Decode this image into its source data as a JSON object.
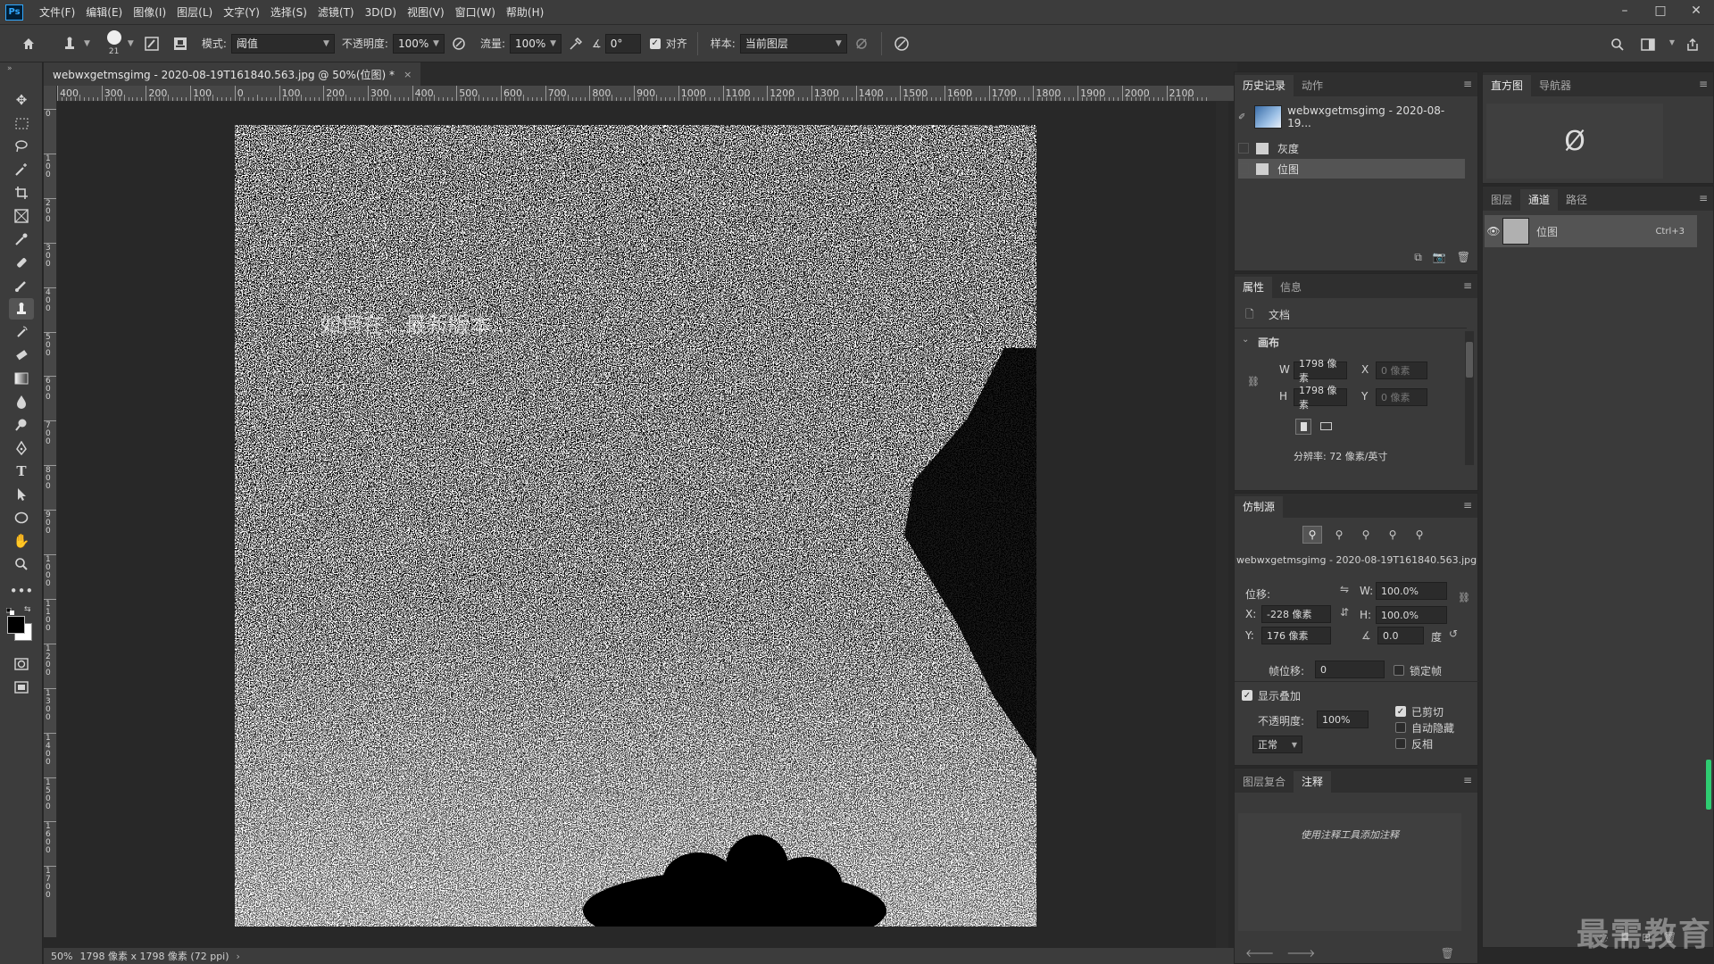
{
  "app": {
    "logo": "Ps"
  },
  "menu": [
    "文件(F)",
    "编辑(E)",
    "图像(I)",
    "图层(L)",
    "文字(Y)",
    "选择(S)",
    "滤镜(T)",
    "3D(D)",
    "视图(V)",
    "窗口(W)",
    "帮助(H)"
  ],
  "window_controls": {
    "minimize": "–",
    "maximize": "□",
    "close": "✕"
  },
  "options": {
    "brush_size": "21",
    "mode_label": "模式:",
    "mode_value": "阈值",
    "opacity_label": "不透明度:",
    "opacity_value": "100%",
    "flow_label": "流量:",
    "flow_value": "100%",
    "angle_value": "0°",
    "align_label": "对齐",
    "sample_label": "样本:",
    "sample_value": "当前图层"
  },
  "document": {
    "tab_title": "webwxgetmsgimg - 2020-08-19T161840.563.jpg @ 50%(位图) *",
    "close": "×",
    "image_text": "如何在…最新版本…"
  },
  "ruler": {
    "h_labels": [
      "400",
      "300",
      "200",
      "100",
      "0",
      "100",
      "200",
      "300",
      "400",
      "500",
      "600",
      "700",
      "800",
      "900",
      "1000",
      "1100",
      "1200",
      "1300",
      "1400",
      "1500",
      "1600",
      "1700",
      "1800",
      "1900",
      "2000",
      "2100"
    ],
    "v_labels": [
      "0",
      "1 0 0",
      "2 0 0",
      "3 0 0",
      "4 0 0",
      "5 0 0",
      "6 0 0",
      "7 0 0",
      "8 0 0",
      "9 0 0",
      "1 0 0 0",
      "1 1 0 0",
      "1 2 0 0",
      "1 3 0 0",
      "1 4 0 0",
      "1 5 0 0",
      "1 6 0 0",
      "1 7 0 0"
    ]
  },
  "status": {
    "zoom": "50%",
    "info": "1798 像素 x 1798 像素 (72 ppi)"
  },
  "history_panel": {
    "tabs": [
      "历史记录",
      "动作"
    ],
    "snapshot": "webwxgetmsgimg - 2020-08-19...",
    "steps": [
      "灰度",
      "位图"
    ]
  },
  "histogram_panel": {
    "tabs": [
      "直方图",
      "导航器"
    ],
    "empty_icon": "Ø"
  },
  "layers_panel": {
    "tabs": [
      "图层",
      "通道",
      "路径"
    ],
    "channel": {
      "name": "位图",
      "shortcut": "Ctrl+3"
    }
  },
  "properties_panel": {
    "tabs": [
      "属性",
      "信息"
    ],
    "doc_label": "文档",
    "section": "画布",
    "w_label": "W",
    "w_value": "1798 像素",
    "h_label": "H",
    "h_value": "1798 像素",
    "x_label": "X",
    "x_value": "0 像素",
    "y_label": "Y",
    "y_value": "0 像素",
    "resolution": "分辨率: 72 像素/英寸"
  },
  "clone_panel": {
    "tab": "仿制源",
    "source": "webwxgetmsgimg - 2020-08-19T161840.563.jpg",
    "offset_label": "位移:",
    "x_label": "X:",
    "x_value": "-228 像素",
    "y_label": "Y:",
    "y_value": "176 像素",
    "w_label": "W:",
    "w_value": "100.0%",
    "h_label": "H:",
    "h_value": "100.0%",
    "angle_value": "0.0",
    "angle_unit": "度",
    "frame_offset_label": "帧位移:",
    "frame_offset_value": "0",
    "lock_frame": "锁定帧",
    "show_overlay": "显示叠加",
    "opacity_label": "不透明度:",
    "opacity_value": "100%",
    "blend_value": "正常",
    "clipped": "已剪切",
    "auto_hide": "自动隐藏",
    "invert": "反相"
  },
  "notes_panel": {
    "tabs": [
      "图层复合",
      "注释"
    ],
    "hint": "使用注释工具添加注释"
  },
  "watermark": "最需教育",
  "colors": {
    "ui_bg": "#3c3c3c",
    "panel_bg": "#3a3a3a",
    "canvas_bg": "#282828",
    "accent": "#31a8ff"
  }
}
